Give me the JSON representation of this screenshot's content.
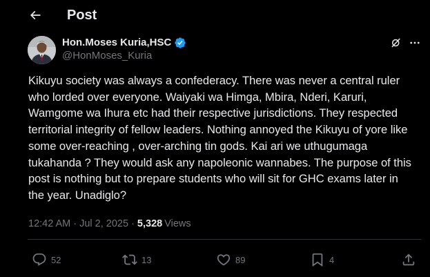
{
  "header": {
    "title": "Post"
  },
  "author": {
    "display_name": "Hon.Moses Kuria,HSC",
    "handle": "@HonMoses_Kuria"
  },
  "post": {
    "text": "Kikuyu society was always a confederacy. There was never a central ruler who lorded over everyone. Waiyaki wa Himga, Mbira, Nderi, Karuri, Wamgome wa Ihura etc had their respective jurisdictions. They respected territorial integrity of fellow leaders. Nothing annoyed the Kikuyu of yore like some over-reaching , over-arching tin gods. Kai ari we uthugumaga tukahanda ? They would ask any napoleonic wannabes. The purpose of this post is nothing but to prepare students who will sit for GHC exams later in the year. Unadiglo?",
    "time": "12:42 AM",
    "separator": "·",
    "date": "Jul 2, 2025",
    "views_count": "5,328",
    "views_label": "Views"
  },
  "actions": {
    "replies": "52",
    "reposts": "13",
    "likes": "89",
    "bookmarks": "4"
  },
  "colors": {
    "background": "#000000",
    "text": "#e7e9ea",
    "secondary": "#71767b",
    "verified": "#1d9bf0",
    "divider": "#2f3336"
  }
}
